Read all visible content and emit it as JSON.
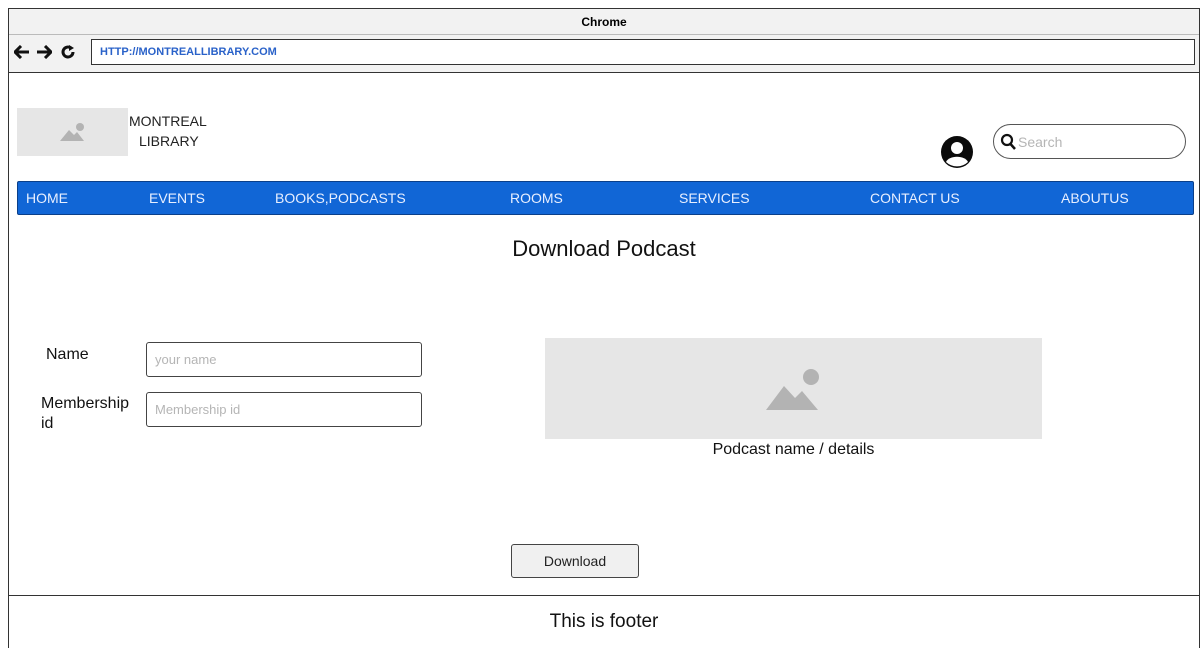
{
  "browser": {
    "title": "Chrome",
    "url": "HTTP://MONTREALLIBRARY.COM",
    "back_icon": "arrow-left-icon",
    "forward_icon": "arrow-right-icon",
    "reload_icon": "reload-icon"
  },
  "header": {
    "brand_line1": "MONTREAL",
    "brand_line2": "LIBRARY",
    "search_placeholder": "Search"
  },
  "nav": {
    "items": [
      "HOME",
      "EVENTS",
      "BOOKS,PODCASTS",
      "ROOMS",
      "SERVICES",
      "CONTACT US",
      "ABOUTUS"
    ]
  },
  "main": {
    "title": "Download Podcast",
    "name_label": "Name",
    "name_placeholder": "your name",
    "membership_label_1": "Membership",
    "membership_label_2": "id",
    "membership_placeholder": "Membership id",
    "podcast_caption": "Podcast name / details",
    "download_label": "Download"
  },
  "footer": {
    "text": "This is footer"
  },
  "colors": {
    "nav_bg": "#1166d6",
    "url_text": "#2a62c9",
    "placeholder_bg": "#e6e6e6"
  }
}
